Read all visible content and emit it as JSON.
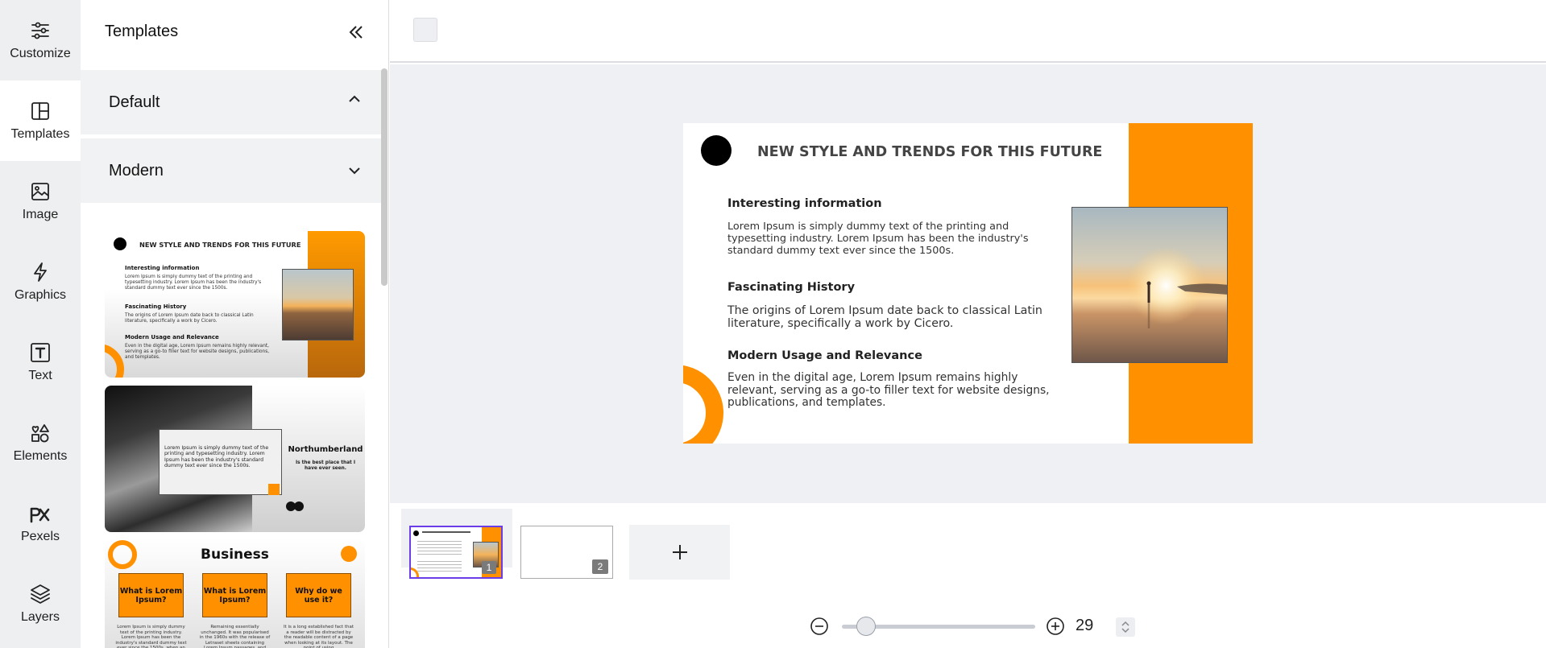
{
  "nav": {
    "items": [
      {
        "label": "Customize",
        "icon": "sliders-icon"
      },
      {
        "label": "Templates",
        "icon": "layout-icon"
      },
      {
        "label": "Image",
        "icon": "image-icon"
      },
      {
        "label": "Graphics",
        "icon": "lightning-icon"
      },
      {
        "label": "Text",
        "icon": "text-icon"
      },
      {
        "label": "Elements",
        "icon": "shapes-icon"
      },
      {
        "label": "Pexels",
        "icon": "pexels-icon"
      },
      {
        "label": "Layers",
        "icon": "layers-icon"
      }
    ],
    "active": "Templates"
  },
  "panel": {
    "title": "Templates",
    "sections": [
      {
        "label": "Default",
        "expanded": true
      },
      {
        "label": "Modern",
        "expanded": false
      }
    ],
    "thumbs": {
      "t1": {
        "title": "NEW STYLE AND TRENDS FOR THIS FUTURE",
        "h1": "Interesting information",
        "p1": "Lorem Ipsum is simply dummy text of the printing and typesetting industry. Lorem Ipsum has been the industry's standard dummy text ever since the 1500s.",
        "h2": "Fascinating History",
        "p2": "The origins of Lorem Ipsum date back to classical Latin literature, specifically a work by Cicero.",
        "h3": "Modern Usage and Relevance",
        "p3": "Even in the digital age, Lorem Ipsum remains highly relevant, serving as a go-to filler text for website designs, publications, and templates."
      },
      "t2": {
        "box_text": "Lorem Ipsum is simply dummy text of the printing and typesetting industry. Lorem Ipsum has been the industry's standard dummy text ever since the 1500s.",
        "heading": "Northumberland",
        "sub": "Is the best place that I have ever seen."
      },
      "t3": {
        "heading": "Business",
        "box1": "What is Lorem Ipsum?",
        "box2": "What is Lorem Ipsum?",
        "box3": "Why do we use it?",
        "col1": "Lorem Ipsum is simply dummy text of the printing industry. Lorem Ipsum has been the industry's standard dummy text ever since the 1500s, when an unknown printer took a galley of type and scrambled it to make a type specimen book. It",
        "col2": "Remaining essentially unchanged. It was popularised in the 1960s with the release of Letraset sheets containing Lorem Ipsum passages, and more recently with desktop",
        "col3": "It is a long established fact that a reader will be distracted by the readable content of a page when looking at its layout. The point of using"
      }
    }
  },
  "slide": {
    "title": "NEW STYLE AND TRENDS FOR THIS FUTURE",
    "h1": "Interesting information",
    "p1": "Lorem Ipsum is simply dummy text of the printing and typesetting industry. Lorem Ipsum has been the industry's standard dummy text ever since the 1500s.",
    "h2": "Fascinating History",
    "p2": "The origins of Lorem Ipsum date back to classical Latin literature, specifically a work by Cicero.",
    "h3": "Modern Usage and Relevance",
    "p3": "Even in the digital age, Lorem Ipsum remains highly relevant, serving as a go-to filler text for website designs, publications, and templates.",
    "accent_color": "#ff9000"
  },
  "pages": [
    {
      "number": "1",
      "selected": true
    },
    {
      "number": "2",
      "selected": false
    }
  ],
  "zoom": {
    "value": "29"
  }
}
